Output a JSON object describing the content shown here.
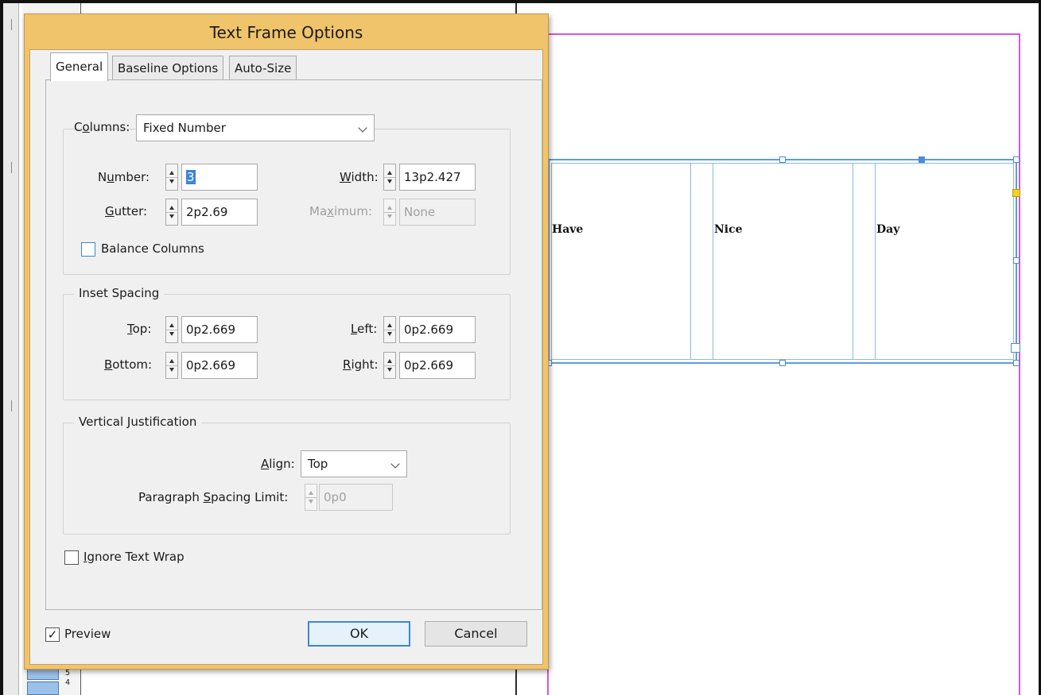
{
  "dialog": {
    "title": "Text Frame Options",
    "tabs": [
      {
        "label": "General"
      },
      {
        "label": "Baseline Options"
      },
      {
        "label": "Auto-Size"
      }
    ],
    "columns": {
      "label_pre": "C",
      "label_u": "o",
      "label_post": "lumns:",
      "type_value": "Fixed Number",
      "number_label_pre": "N",
      "number_label_u": "u",
      "number_label_post": "mber:",
      "number_value": "3",
      "width_label_u": "W",
      "width_label_post": "idth:",
      "width_value": "13p2.427",
      "gutter_label_u": "G",
      "gutter_label_post": "utter:",
      "gutter_value": "2p2.69",
      "maximum_label_pre": "Ma",
      "maximum_label_u": "x",
      "maximum_label_post": "imum:",
      "maximum_value": "None",
      "balance_label": "Balance Columns"
    },
    "inset": {
      "title": "Inset Spacing",
      "top_label_u": "T",
      "top_label_post": "op:",
      "top_value": "0p2.669",
      "bottom_label_u": "B",
      "bottom_label_post": "ottom:",
      "bottom_value": "0p2.669",
      "left_label_u": "L",
      "left_label_post": "eft:",
      "left_value": "0p2.669",
      "right_label_u": "R",
      "right_label_post": "ight:",
      "right_value": "0p2.669"
    },
    "vertical": {
      "title": "Vertical Justification",
      "align_label_u": "A",
      "align_label_post": "lign:",
      "align_value": "Top",
      "para_label_pre": "Paragraph ",
      "para_label_u": "S",
      "para_label_post": "pacing Limit:",
      "para_value": "0p0"
    },
    "ignore_wrap_u": "I",
    "ignore_wrap_post": "gnore Text Wrap",
    "preview_label": "Preview",
    "preview_checked": "✓",
    "ok_label": "OK",
    "cancel_label": "Cancel"
  },
  "document": {
    "words": [
      "Have",
      "Nice",
      "Day"
    ]
  },
  "pages_panel": {
    "page_a": "5",
    "page_b": "4"
  },
  "colors": {
    "dialog_title_bar": "#f0c46a",
    "frame_border": "#5b9be0",
    "page_margin": "#d555e0",
    "selection": "#3b84d8"
  }
}
